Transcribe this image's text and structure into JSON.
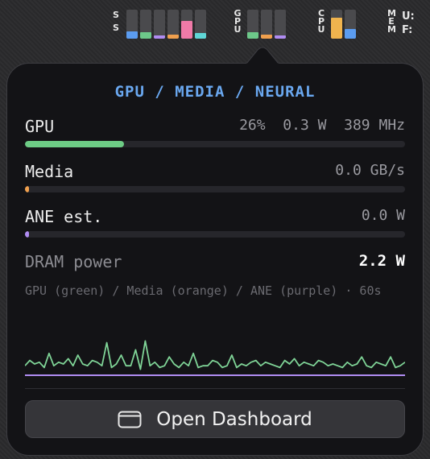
{
  "menubar": {
    "ss": {
      "l1": "S",
      "l2": "S",
      "levels": [
        0.25,
        0.22,
        0.12,
        0.14,
        0.62,
        0.2
      ],
      "colors": [
        "#5b9cf0",
        "#6dc88a",
        "#b08cf2",
        "#f0a04e",
        "#f07aa8",
        "#5fd6d6"
      ]
    },
    "gpu": {
      "l1": "G",
      "l2": "P",
      "l3": "U",
      "levels": [
        0.22,
        0.14,
        0.12
      ],
      "colors": [
        "#6dc88a",
        "#f0a04e",
        "#b08cf2"
      ]
    },
    "cpu": {
      "l1": "C",
      "l2": "P",
      "l3": "U",
      "levels": [
        0.72,
        0.32
      ],
      "colors": [
        "#f0b44e",
        "#5b9cf0"
      ]
    },
    "mem": {
      "l1": "M",
      "l2": "E",
      "l3": "M",
      "u": "U:",
      "f": "F:"
    }
  },
  "popover": {
    "title": "GPU / MEDIA / NEURAL",
    "gpu": {
      "label": "GPU",
      "value": "26%  0.3 W  389 MHz",
      "level": 0.26,
      "color": "#6dcc85"
    },
    "media": {
      "label": "Media",
      "value": "0.0 GB/s",
      "level": 0.01,
      "color": "#f0a04e"
    },
    "ane": {
      "label": "ANE est.",
      "value": "0.0 W",
      "level": 0.01,
      "color": "#b08cf2"
    },
    "dram": {
      "label": "DRAM power",
      "value": "2.2 W"
    },
    "caption": "GPU (green) / Media (orange) / ANE (purple) · 60s",
    "sparkline": {
      "gpu": [
        0.2,
        0.35,
        0.25,
        0.3,
        0.15,
        0.55,
        0.2,
        0.3,
        0.25,
        0.4,
        0.2,
        0.5,
        0.25,
        0.2,
        0.35,
        0.3,
        0.2,
        0.85,
        0.15,
        0.25,
        0.5,
        0.2,
        0.2,
        0.65,
        0.1,
        0.9,
        0.2,
        0.3,
        0.15,
        0.2,
        0.45,
        0.25,
        0.15,
        0.3,
        0.2,
        0.55,
        0.15,
        0.2,
        0.2,
        0.35,
        0.3,
        0.15,
        0.2,
        0.5,
        0.15,
        0.25,
        0.2,
        0.3,
        0.35,
        0.2,
        0.3,
        0.25,
        0.2,
        0.15,
        0.35,
        0.25,
        0.4,
        0.2,
        0.3,
        0.25,
        0.2,
        0.35,
        0.3,
        0.2,
        0.25,
        0.2,
        0.15,
        0.3,
        0.2,
        0.25,
        0.45,
        0.2,
        0.15,
        0.3,
        0.25,
        0.2,
        0.45,
        0.15,
        0.2,
        0.3
      ],
      "ane_level": 0.0,
      "colors": {
        "gpu": "#7fd497",
        "ane": "#b08cf2"
      }
    },
    "button": {
      "label": "Open Dashboard",
      "icon": "window-icon"
    }
  }
}
